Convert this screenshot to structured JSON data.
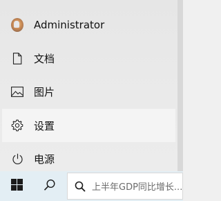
{
  "start_menu": {
    "items": [
      {
        "label": "Administrator",
        "icon": "user-avatar-icon"
      },
      {
        "label": "文档",
        "icon": "document-icon"
      },
      {
        "label": "图片",
        "icon": "picture-icon"
      },
      {
        "label": "设置",
        "icon": "gear-icon"
      },
      {
        "label": "电源",
        "icon": "power-icon"
      }
    ]
  },
  "taskbar": {
    "start_icon": "windows-logo-icon",
    "search_icon": "search-icon",
    "search_placeholder": "上半年GDP同比增长..."
  },
  "colors": {
    "menu_bg": "#e9e9e9",
    "hover_bg": "#f4f4f4",
    "taskbar_bg": "#e3eef4",
    "searchbox_bg": "#ffffff"
  }
}
